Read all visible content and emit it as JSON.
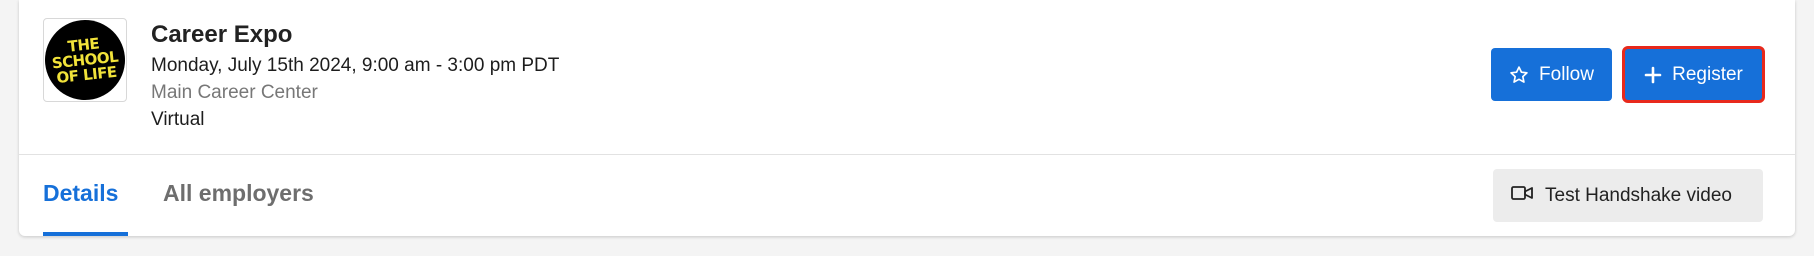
{
  "event": {
    "title": "Career Expo",
    "datetime": "Monday, July 15th 2024, 9:00 am - 3:00 pm PDT",
    "location": "Main Career Center",
    "format": "Virtual",
    "logo_lines": [
      "THE",
      "SCHOOL",
      "OF LIFE"
    ]
  },
  "actions": {
    "follow_label": "Follow",
    "register_label": "Register"
  },
  "tabs": [
    {
      "label": "Details",
      "active": true
    },
    {
      "label": "All employers",
      "active": false
    }
  ],
  "video_button": {
    "label": "Test Handshake video",
    "icon": "video-camera-icon"
  },
  "colors": {
    "primary": "#1670d9",
    "highlight": "#e8291c",
    "logo_text": "#f2e33a"
  }
}
